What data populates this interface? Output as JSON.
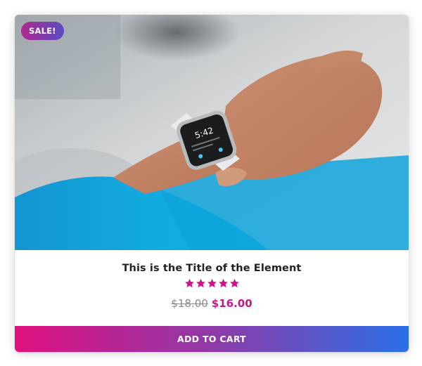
{
  "card": {
    "badge": "SALE!",
    "image_alt": "Hand tapping a smartwatch on a wrist",
    "watch_time": "5:42",
    "title": "This is the Title of the Element",
    "rating": 5,
    "rating_max": 5,
    "old_price": "$18.00",
    "new_price": "$16.00",
    "button_label": "ADD TO CART"
  },
  "colors": {
    "accent_pink": "#c8178a",
    "button_gradient_start": "#e0107f",
    "button_gradient_end": "#2b6fe6",
    "badge_gradient_start": "#b0288f",
    "badge_gradient_end": "#5a4cc4"
  },
  "icons": {
    "star": "star-icon"
  }
}
